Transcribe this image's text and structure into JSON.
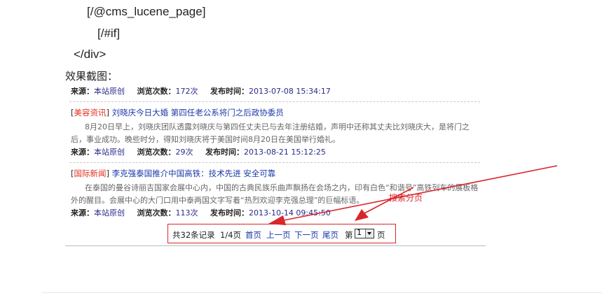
{
  "code": {
    "line1": "[/@cms_lucene_page]",
    "line2": "[/#if]",
    "line3": "</div>"
  },
  "caption": "效果截图：",
  "labels": {
    "source": "来源：",
    "views": "浏览次数：",
    "published": "发布时间："
  },
  "items": [
    {
      "source": "本站原创",
      "views": "172次",
      "published": "2013-07-08 15:34:17"
    },
    {
      "category": "美容资讯",
      "title": "刘晓庆今日大婚 第四任老公系将门之后政协委员",
      "summary": "8月20日早上，刘晓庆团队透露刘晓庆与第四任丈夫已与去年注册结婚，声明中还称其丈夫比刘晓庆大，是将门之后，事业成功。晚些时分，得知刘晓庆将于美国时间8月20日在美国举行婚礼。",
      "source": "本站原创",
      "views": "29次",
      "published": "2013-08-21 15:12:25"
    },
    {
      "category": "国际新闻",
      "title": "李克强泰国推介中国高铁：技术先进 安全可靠",
      "summary": "在泰国的曼谷诗丽吉国家会展中心内，中国的古典民族乐曲声飘扬在会场之内，印有白色“和谐号”高铁列车的展板格外的醒目。会展中心的大门口用中泰两国文字写着“热烈欢迎李克强总理”的巨幅标语。",
      "source": "本站原创",
      "views": "113次",
      "published": "2013-10-14 09:45:50"
    }
  ],
  "pager": {
    "summary": "共32条记录",
    "pages": "1/4页",
    "first": "首页",
    "prev": "上一页",
    "next": "下一页",
    "last": "尾页",
    "goto_prefix": "第",
    "goto_value": "1",
    "goto_suffix": "页"
  },
  "annotation": "搜索分页",
  "colors": {
    "category": "#e03020",
    "link": "#1a3aa8",
    "highlight_box": "#d9262a"
  }
}
